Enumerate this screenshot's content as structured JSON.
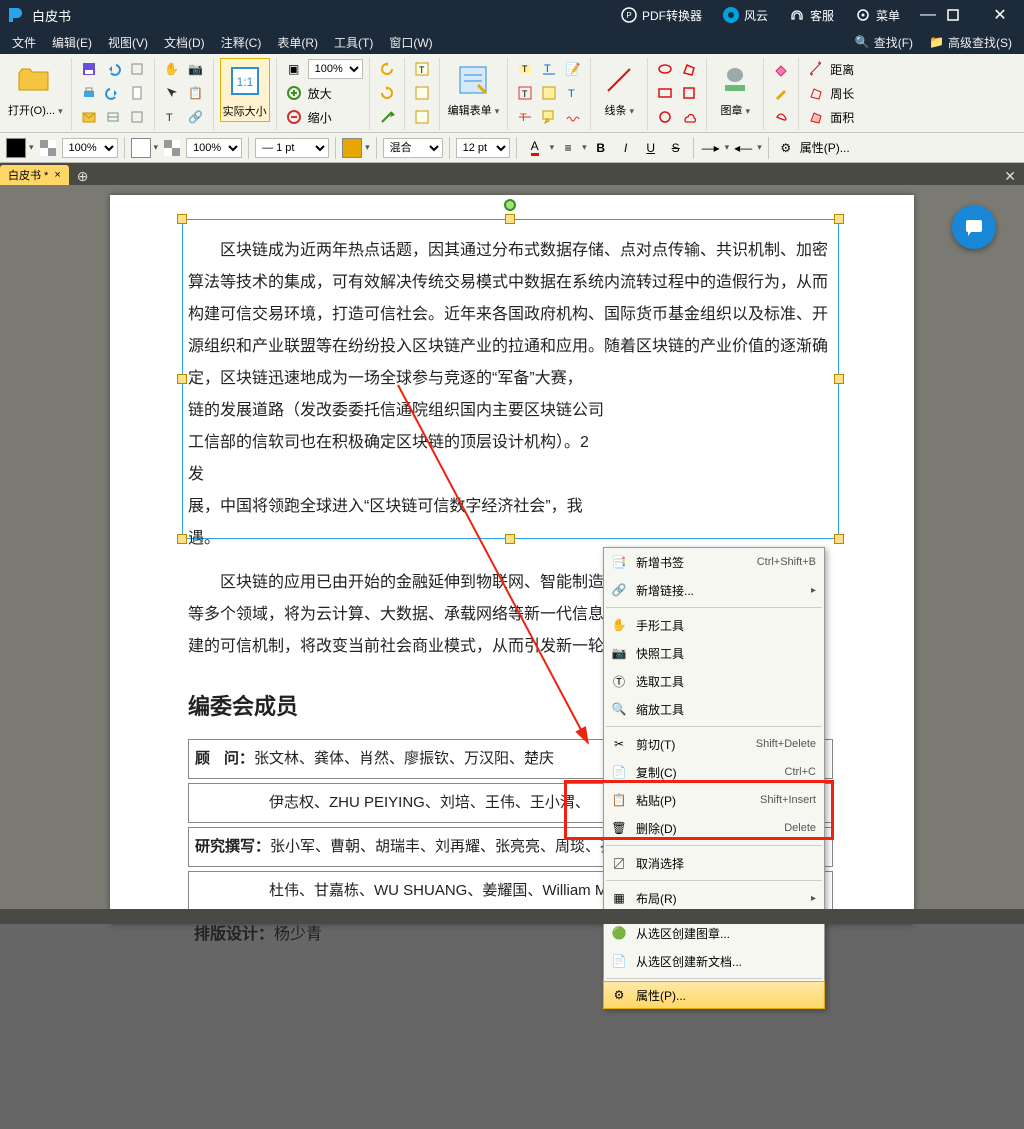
{
  "titlebar": {
    "app_title": "白皮书",
    "converter": "PDF转换器",
    "fengyun": "风云",
    "support": "客服",
    "menu": "菜单"
  },
  "menubar": {
    "file": "文件",
    "edit": "编辑(E)",
    "view": "视图(V)",
    "doc": "文档(D)",
    "annot": "注释(C)",
    "form": "表单(R)",
    "tool": "工具(T)",
    "window": "窗口(W)",
    "find": "查找(F)",
    "advfind": "高级查找(S)"
  },
  "ribbon": {
    "open": "打开(O)...",
    "actual": "实际大小",
    "zoom": "100%",
    "enlarge": "放大",
    "shrink": "缩小",
    "editform": "编辑表单",
    "line": "线条",
    "stamp": "图章",
    "dist": "距离",
    "perim": "周长",
    "area": "面积"
  },
  "fmt": {
    "opacity1": "100%",
    "opacity2": "100%",
    "ptsize": "— 1 pt",
    "blend": "混合",
    "fontsize": "12 pt",
    "prop": "属性(P)..."
  },
  "tab": {
    "name": "白皮书 *"
  },
  "doc": {
    "p1": "区块链成为近两年热点话题，因其通过分布式数据存储、点对点传输、共识机制、加密算法等技术的集成，可有效解决传统交易模式中数据在系统内流转过程中的造假行为，从而构建可信交易环境，打造可信社会。近年来各国政府机构、国际货币基金组织以及标准、开源组织和产业联盟等在纷纷投入区块链产业的拉通和应用。随着区块链的产业价值的逐渐确定，区块链迅速地成为一场全球参与竞逐的“军备”大赛，",
    "p1b": "链的发展道路（发改委委托信通院组织国内主要区块链公司",
    "p1c": "工信部的信软司也在积极确定区块链的顶层设计机构）。2",
    "p1d": "发",
    "p2": "展，中国将领跑全球进入“区块链可信数字经济社会”，我",
    "p2b": "遇。",
    "p3": "区块链的应用已由开始的金融延伸到物联网、智能制造",
    "p3b": "等多个领域，将为云计算、大数据、承载网络等新一代信息",
    "p3c": "建的可信机制，将改变当前社会商业模式，从而引发新一轮",
    "hdr": "编委会成员",
    "row1_a": "顾",
    "row1_b": "问：",
    "row1_c": "张文林、龚体、肖然、廖振钦、万汉阳、楚庆",
    "row2": "伊志权、ZHU PEIYING、刘培、王伟、王小渭、",
    "row3_a": "研究撰写：",
    "row3_b": "张小军、曹朝、胡瑞丰、刘再耀、张亮亮、周琰、孙琳琳、安刚、",
    "row4": "杜伟、甘嘉栋、WU SHUANG、姜耀国、William Michael Genovese、朱朝晖",
    "row5_a": "排版设计：",
    "row5_b": "杨少青"
  },
  "ctx": {
    "bookmark": "新增书签",
    "bookmark_sc": "Ctrl+Shift+B",
    "link": "新增链接...",
    "hand": "手形工具",
    "snapshot": "快照工具",
    "select": "选取工具",
    "zoom": "缩放工具",
    "cut": "剪切(T)",
    "cut_sc": "Shift+Delete",
    "copy": "复制(C)",
    "copy_sc": "Ctrl+C",
    "paste": "粘贴(P)",
    "paste_sc": "Shift+Insert",
    "delete": "删除(D)",
    "delete_sc": "Delete",
    "deselect": "取消选择",
    "layout": "布局(R)",
    "stamp": "从选区创建图章...",
    "newdoc": "从选区创建新文档...",
    "prop": "属性(P)..."
  }
}
